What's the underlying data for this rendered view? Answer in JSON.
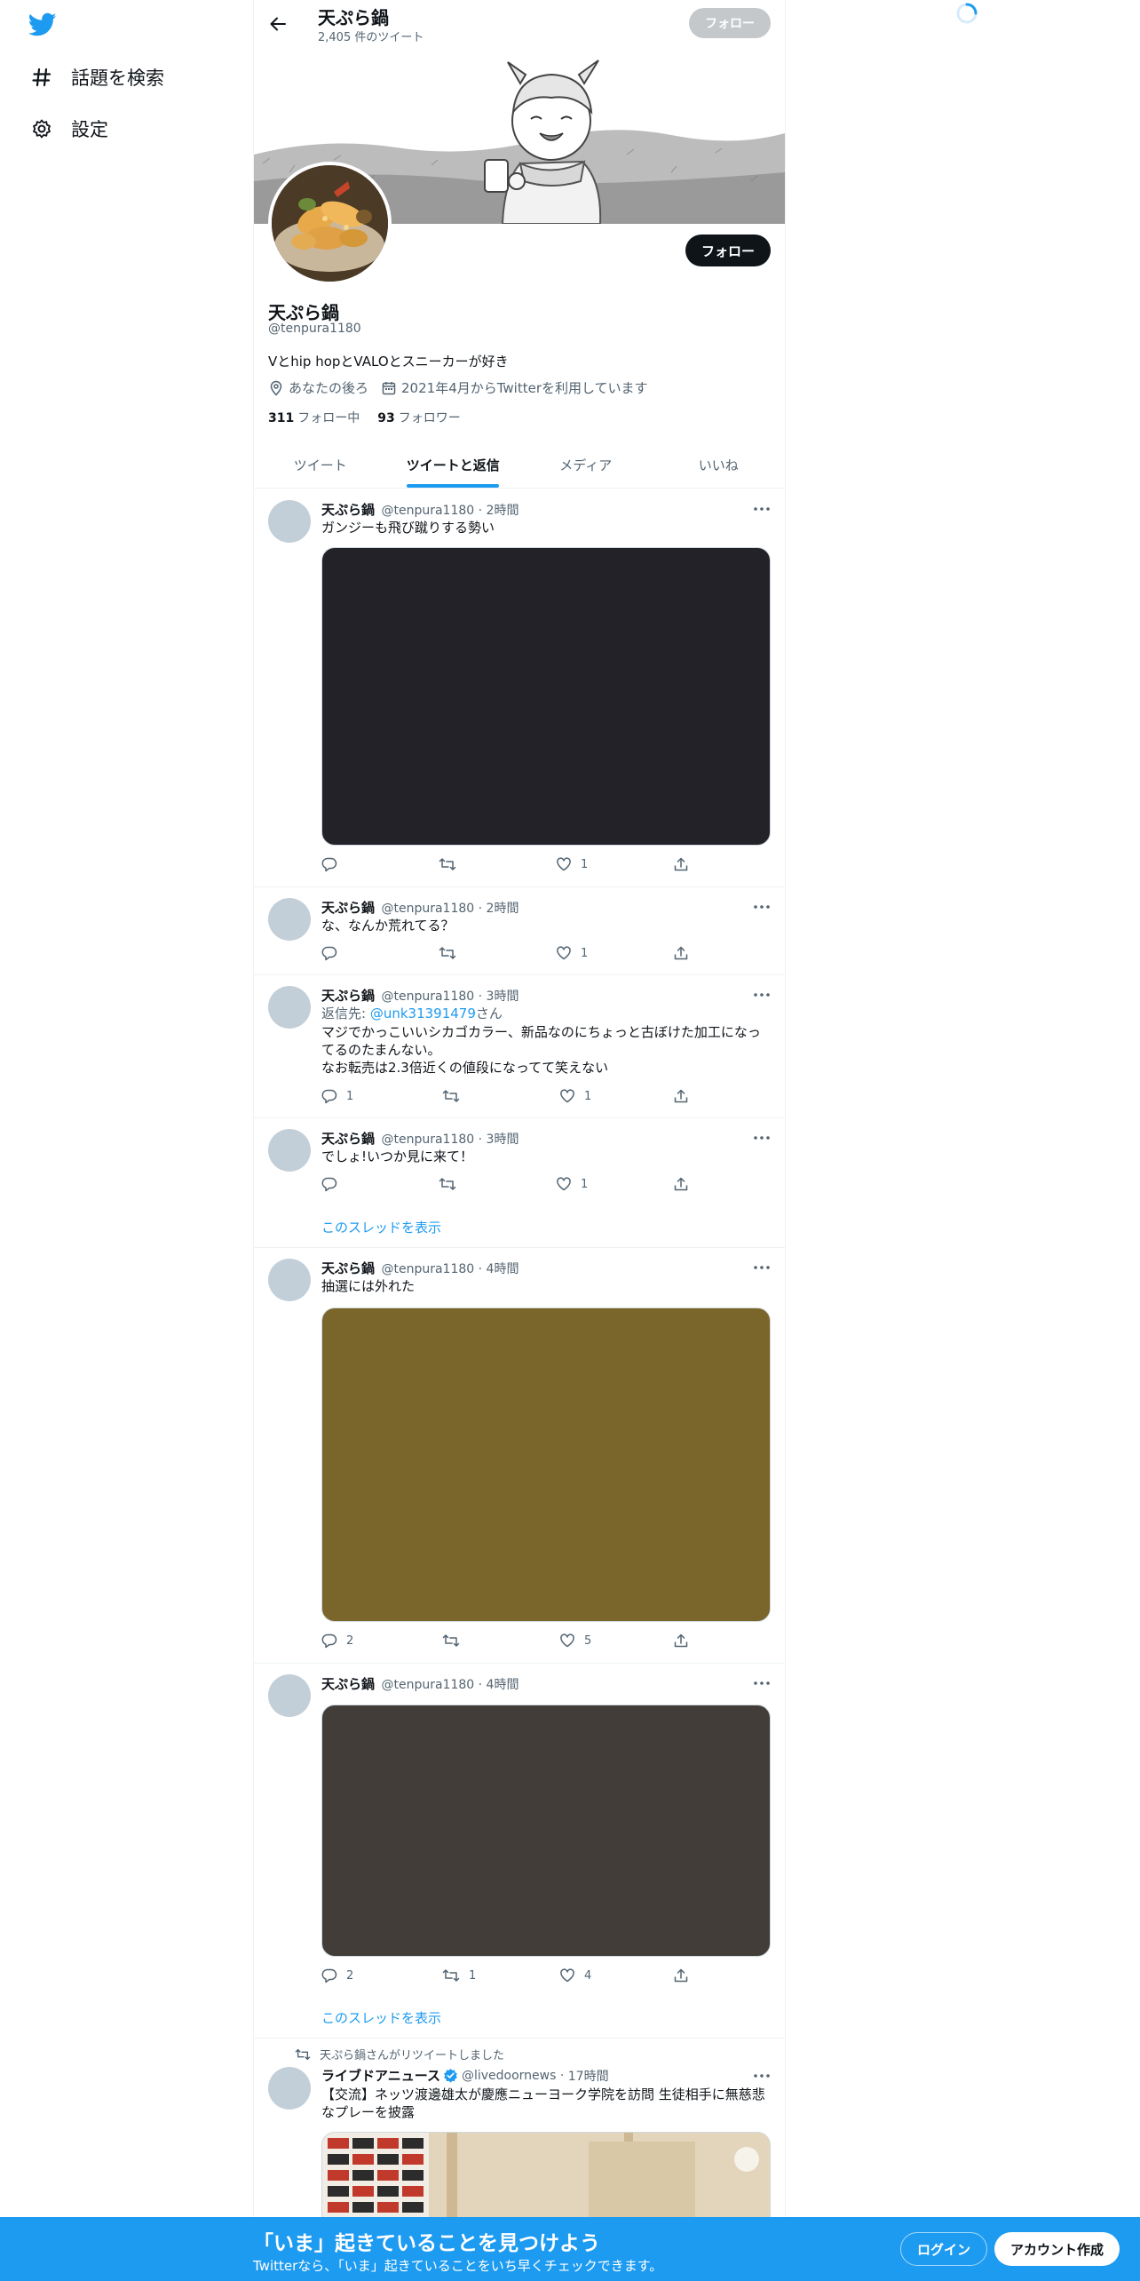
{
  "sidebar": {
    "logo": "twitter-bird-icon",
    "items": [
      {
        "icon": "hashtag-icon",
        "label": "話題を検索"
      },
      {
        "icon": "gear-icon",
        "label": "設定"
      }
    ]
  },
  "header": {
    "name": "天ぷら鍋",
    "tweet_count": "2,405 件のツイート",
    "follow_label": "フォロー"
  },
  "profile": {
    "name": "天ぷら鍋",
    "handle": "@tenpura1180",
    "bio": "Vとhip hopとVALOとスニーカーが好き",
    "location": "あなたの後ろ",
    "joined": "2021年4月からTwitterを利用しています",
    "following_count": "311",
    "following_label": "フォロー中",
    "followers_count": "93",
    "followers_label": "フォロワー",
    "follow_label": "フォロー"
  },
  "tabs": [
    {
      "label": "ツイート",
      "active": false
    },
    {
      "label": "ツイートと返信",
      "active": true
    },
    {
      "label": "メディア",
      "active": false
    },
    {
      "label": "いいね",
      "active": false
    }
  ],
  "tweets": [
    {
      "name": "天ぷら鍋",
      "handle": "@tenpura1180",
      "time": "2時間",
      "text": "ガンジーも飛び蹴りする勢い",
      "media_color": "#232228",
      "replies": "",
      "retweets": "",
      "likes": "1"
    },
    {
      "name": "天ぷら鍋",
      "handle": "@tenpura1180",
      "time": "2時間",
      "text": "な、なんか荒れてる？",
      "replies": "",
      "retweets": "",
      "likes": "1"
    },
    {
      "name": "天ぷら鍋",
      "handle": "@tenpura1180",
      "time": "3時間",
      "reply_prefix": "返信先: ",
      "reply_to": "@unk31391479",
      "reply_suffix": "さん",
      "text_lines": [
        "マジでかっこいいシカゴカラー、新品なのにちょっと古ぼけた加工になっ",
        "てるのたまんない。",
        "なお転売は2.3倍近くの値段になってて笑えない"
      ],
      "replies": "1",
      "retweets": "",
      "likes": "1"
    },
    {
      "name": "天ぷら鍋",
      "handle": "@tenpura1180",
      "time": "3時間",
      "text": "でしょ!いつか見に来て！",
      "replies": "",
      "retweets": "",
      "likes": "1",
      "thread_label": "このスレッドを表示"
    },
    {
      "name": "天ぷら鍋",
      "handle": "@tenpura1180",
      "time": "4時間",
      "text": "抽選には外れた",
      "media_color": "#7a652a",
      "replies": "2",
      "retweets": "",
      "likes": "5"
    },
    {
      "name": "天ぷら鍋",
      "handle": "@tenpura1180",
      "time": "4時間",
      "media_color": "#423d38",
      "replies": "2",
      "retweets": "1",
      "likes": "4",
      "thread_label": "このスレッドを表示"
    },
    {
      "retweet_note": "天ぷら鍋さんがリツイートしました",
      "name": "ライブドアニュース",
      "handle": "@livedoornews",
      "time": "17時間",
      "verified": true,
      "text_lines": [
        "【交流】ネッツ渡邊雄太が慶應ニューヨーク学院を訪問 生徒相手に無慈悲",
        "なプレーを披露"
      ]
    }
  ],
  "bottom_bar": {
    "title": "「いま」起きていることを見つけよう",
    "subtitle": "Twitterなら、「いま」起きていることをいち早くチェックできます。",
    "login_label": "ログイン",
    "signup_label": "アカウント作成"
  },
  "colors": {
    "accent": "#1d9bf0",
    "text": "#0f1419",
    "muted": "#536471"
  }
}
